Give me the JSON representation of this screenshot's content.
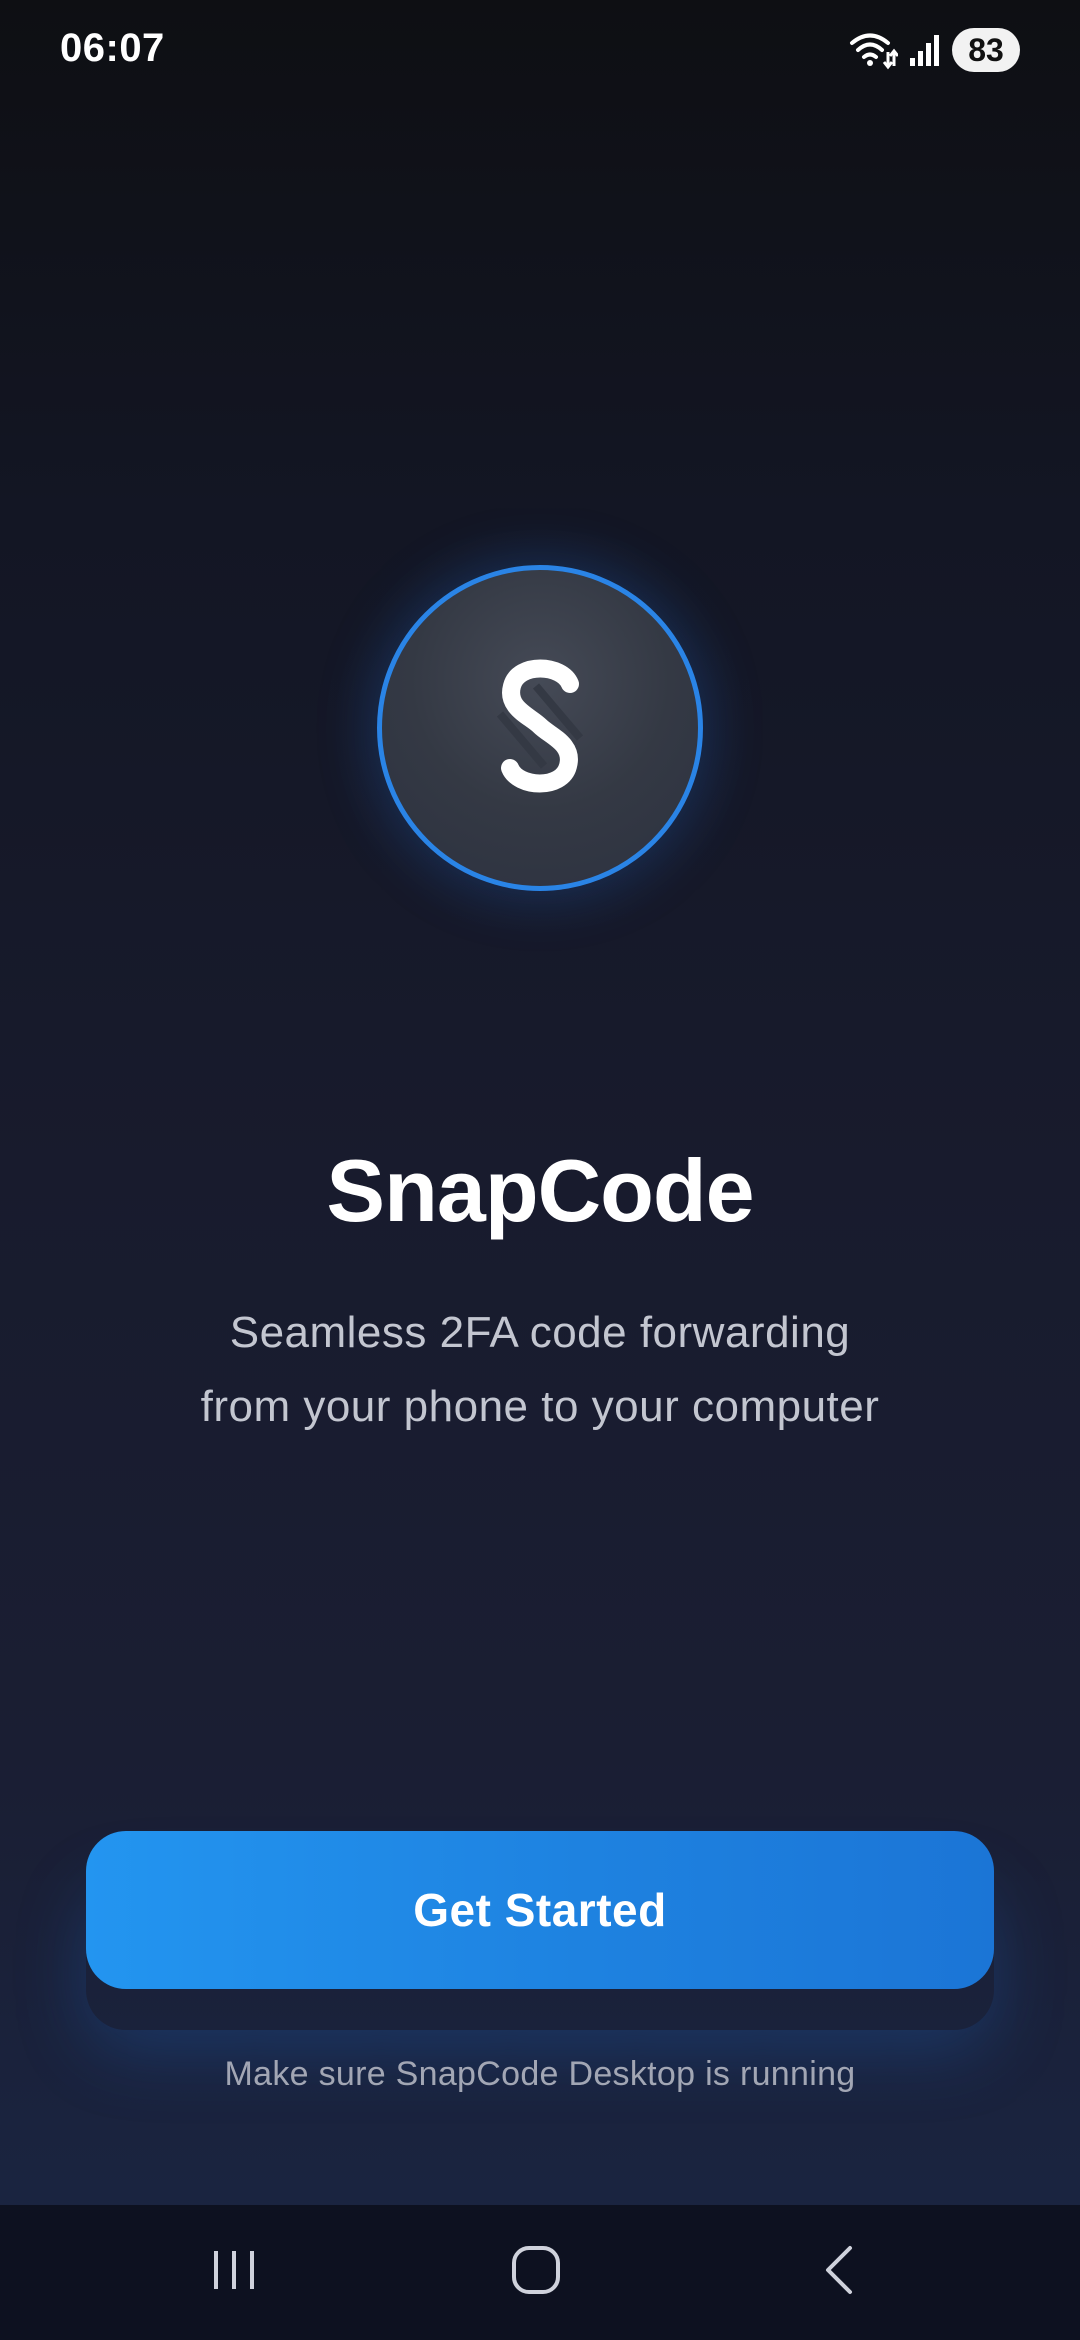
{
  "status_bar": {
    "time": "06:07",
    "battery_level": "83",
    "icons": [
      "wifi-icon",
      "signal-icon",
      "battery-icon"
    ]
  },
  "logo": {
    "icon": "snapcode-logo-icon",
    "ring_color": "#2a84e6"
  },
  "app": {
    "title": "SnapCode",
    "subtitle_line1": "Seamless 2FA code forwarding",
    "subtitle_line2": "from your phone to your computer"
  },
  "actions": {
    "get_started_label": "Get Started",
    "hint": "Make sure SnapCode Desktop is running",
    "accent_color": "#1e82e0"
  },
  "nav_bar": {
    "icons": [
      "recents-icon",
      "home-icon",
      "back-icon"
    ]
  }
}
